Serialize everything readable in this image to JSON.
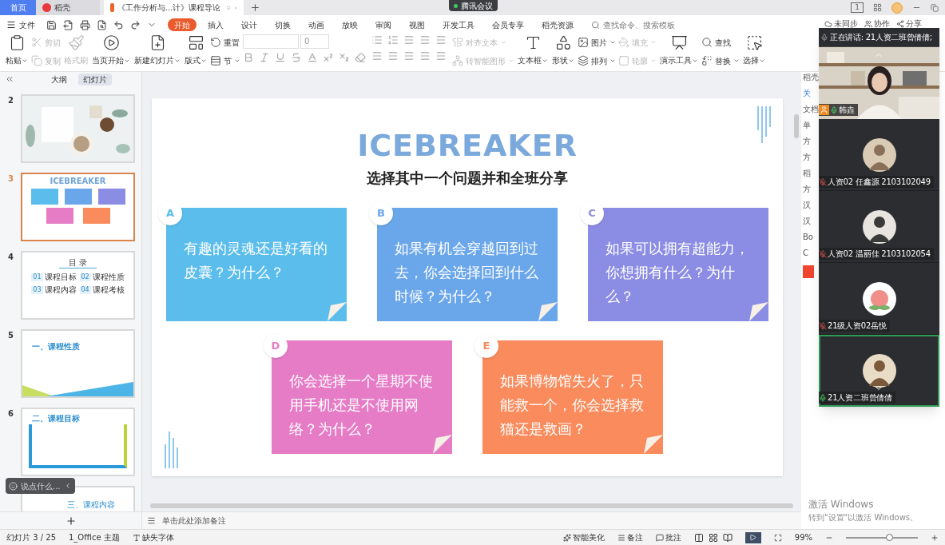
{
  "tabs": [
    {
      "label": "首页",
      "selected": false,
      "kind": "home"
    },
    {
      "label": "稻壳",
      "selected": false,
      "kind": "docer"
    },
    {
      "label": "《工作分析与...计》课程导论",
      "selected": true,
      "kind": "document"
    }
  ],
  "meeting_badge": {
    "label": "腾讯会议"
  },
  "window_controls": {
    "layout_badge": "1"
  },
  "menu": {
    "file": "文件",
    "tabs": [
      {
        "label": "开始",
        "selected": true
      },
      {
        "label": "插入",
        "selected": false
      },
      {
        "label": "设计",
        "selected": false
      },
      {
        "label": "切换",
        "selected": false
      },
      {
        "label": "动画",
        "selected": false
      },
      {
        "label": "放映",
        "selected": false
      },
      {
        "label": "审阅",
        "selected": false
      },
      {
        "label": "视图",
        "selected": false
      },
      {
        "label": "开发工具",
        "selected": false
      },
      {
        "label": "会员专享",
        "selected": false
      },
      {
        "label": "稻壳资源",
        "selected": false
      }
    ],
    "search_placeholder": "查找命令、搜索模板"
  },
  "ribbon": [
    {
      "kind": "large",
      "label": "粘贴",
      "dropdown": true,
      "disabled": false
    },
    {
      "kind": "stack",
      "items": [
        {
          "label": "剪切",
          "dropdown": false,
          "disabled": true
        },
        {
          "label": "复制",
          "dropdown": false,
          "disabled": true
        }
      ]
    },
    {
      "kind": "large",
      "label": "格式刷",
      "dropdown": false,
      "disabled": true
    },
    {
      "kind": "large",
      "label": "当页开始",
      "dropdown": true,
      "disabled": false
    },
    {
      "kind": "large",
      "label": "新建幻灯片",
      "dropdown": true,
      "disabled": false
    },
    {
      "kind": "large",
      "label": "版式",
      "dropdown": true,
      "disabled": false
    },
    {
      "kind": "stack",
      "items": [
        {
          "label": "重置",
          "dropdown": false,
          "disabled": false
        },
        {
          "label": "节",
          "dropdown": true,
          "disabled": false
        }
      ]
    },
    {
      "kind": "font",
      "font_size": "0"
    },
    {
      "kind": "paragraph"
    },
    {
      "kind": "stack",
      "items": [
        {
          "label": "对齐文本",
          "dropdown": true,
          "disabled": true
        },
        {
          "label": "转智能图形",
          "dropdown": true,
          "disabled": true
        }
      ]
    },
    {
      "kind": "large",
      "label": "文本框",
      "dropdown": true,
      "disabled": false
    },
    {
      "kind": "large",
      "label": "形状",
      "dropdown": true,
      "disabled": false
    },
    {
      "kind": "stack",
      "items": [
        {
          "label": "图片",
          "dropdown": true,
          "disabled": false
        },
        {
          "label": "排列",
          "dropdown": true,
          "disabled": false
        }
      ]
    },
    {
      "kind": "stack",
      "items": [
        {
          "label": "填充",
          "dropdown": true,
          "disabled": true
        },
        {
          "label": "轮廓",
          "dropdown": true,
          "disabled": true
        }
      ]
    },
    {
      "kind": "large",
      "label": "演示工具",
      "dropdown": true,
      "disabled": false
    },
    {
      "kind": "stack",
      "items": [
        {
          "label": "查找",
          "dropdown": false,
          "disabled": false
        },
        {
          "label": "替换",
          "dropdown": true,
          "disabled": false
        }
      ]
    },
    {
      "kind": "large",
      "label": "选择",
      "dropdown": true,
      "disabled": false
    }
  ],
  "cloud_actions": [
    "未同步",
    "协作",
    "分享"
  ],
  "slides_panel": {
    "tabs": [
      {
        "label": "大纲",
        "selected": false
      },
      {
        "label": "幻灯片",
        "selected": true
      }
    ],
    "thumbnails": [
      {
        "number": "2",
        "selected": false
      },
      {
        "number": "3",
        "selected": true,
        "kind": "icebreaker",
        "title": "ICEBREAKER"
      },
      {
        "number": "4",
        "selected": false,
        "kind": "toc",
        "title": "目 录",
        "items": [
          {
            "num": "01",
            "label": "课程目标"
          },
          {
            "num": "02",
            "label": "课程性质"
          },
          {
            "num": "03",
            "label": "课程内容"
          },
          {
            "num": "04",
            "label": "课程考核"
          }
        ]
      },
      {
        "number": "5",
        "selected": false,
        "kind": "section",
        "title": "一、课程性质"
      },
      {
        "number": "6",
        "selected": false,
        "kind": "section_frame",
        "title": "二、课程目标"
      },
      {
        "selected": false,
        "kind": "section_cut",
        "title": "三、课程内容"
      }
    ]
  },
  "chat_pill": {
    "placeholder": "说点什么..."
  },
  "slide": {
    "title": "ICEBREAKER",
    "subtitle": "选择其中一个问题并和全班分享",
    "cards": [
      {
        "letter": "A",
        "text": "有趣的灵魂还是好看的皮囊？为什么？",
        "color": "#5bbdec"
      },
      {
        "letter": "B",
        "text": "如果有机会穿越回到过去，你会选择回到什么时候？为什么？",
        "color": "#6aa6ea"
      },
      {
        "letter": "C",
        "text": "如果可以拥有超能力，你想拥有什么？为什么？",
        "color": "#8b8ce3"
      },
      {
        "letter": "D",
        "text": "你会选择一个星期不使用手机还是不使用网络？为什么？",
        "color": "#e67cc6"
      },
      {
        "letter": "E",
        "text": "如果博物馆失火了，只能救一个，你会选择救猫还是救画？",
        "color": "#f98b5c"
      }
    ]
  },
  "notes_placeholder": "单击此处添加备注",
  "side_panel": [
    "稻壳",
    "关",
    "文档",
    "单",
    "方",
    "方",
    "稻",
    "方",
    "汉",
    "汉",
    "Bo",
    "C"
  ],
  "meeting": {
    "speaking": "正在讲话: 21人资二班曾倩倩;",
    "participants": [
      {
        "name": "韩垚",
        "kind": "video",
        "muted": false,
        "host": true,
        "active": false
      },
      {
        "name": "人资02 任鑫源 2103102049",
        "kind": "avatar",
        "muted": true,
        "host": false,
        "active": false
      },
      {
        "name": "人资02 温丽佳 2103102054",
        "kind": "avatar",
        "muted": true,
        "host": false,
        "active": false
      },
      {
        "name": "21级人资02岳悦",
        "kind": "avatar",
        "muted": true,
        "host": false,
        "active": false
      },
      {
        "name": "21人资二班曾倩倩",
        "kind": "avatar",
        "muted": false,
        "host": false,
        "active": true
      }
    ]
  },
  "activation": {
    "title": "激活 Windows",
    "hint": "转到\"设置\"以激活 Windows。"
  },
  "status_bar": {
    "slide": "幻灯片 3 / 25",
    "theme": "1_Office 主题",
    "missing_fonts": "缺失字体",
    "beautify": "智能美化",
    "notes": "备注",
    "comments": "批注",
    "zoom": "99%",
    "zoom_slider": {
      "level": 0.6
    }
  }
}
